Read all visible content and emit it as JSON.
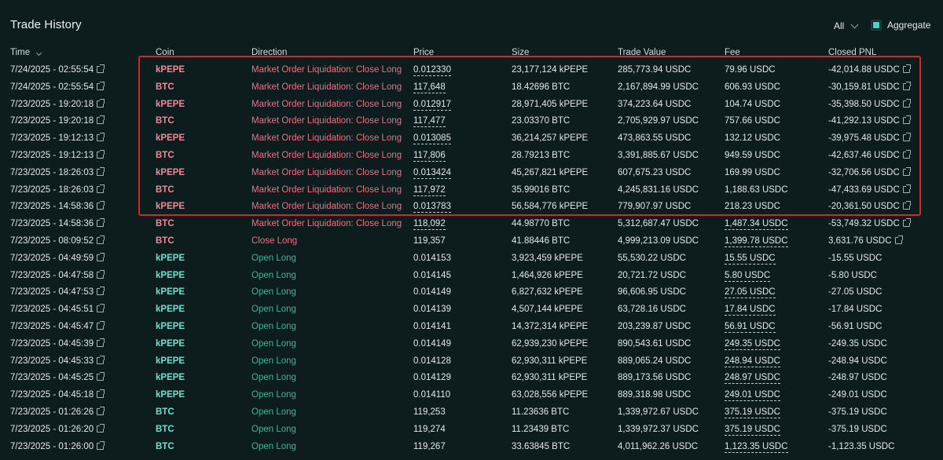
{
  "header": {
    "title": "Trade History",
    "filter_label": "All",
    "aggregate_label": "Aggregate",
    "aggregate_checked": true
  },
  "columns": [
    "Time",
    "Coin",
    "Direction",
    "Price",
    "Size",
    "Trade Value",
    "Fee",
    "Closed PNL"
  ],
  "colors": {
    "background": "#0d1c1c",
    "sell": "#ec7085",
    "buy": "#3bb79a",
    "coin_buy": "#69e3d0",
    "highlight_box": "#d2262b",
    "checkbox": "#51d2c1"
  },
  "rows": [
    {
      "time": "7/24/2025 - 02:55:54",
      "coin": "kPEPE",
      "direction": "Market Order Liquidation: Close Long",
      "price": "0.012330",
      "size": "23,177,124 kPEPE",
      "trade_value": "285,773.94 USDC",
      "fee": "79.96 USDC",
      "pnl": "-42,014.88 USDC",
      "side": "sell",
      "fee_ul": false
    },
    {
      "time": "7/24/2025 - 02:55:54",
      "coin": "BTC",
      "direction": "Market Order Liquidation: Close Long",
      "price": "117,648",
      "size": "18.42696 BTC",
      "trade_value": "2,167,894.99 USDC",
      "fee": "606.93 USDC",
      "pnl": "-30,159.81 USDC",
      "side": "sell",
      "fee_ul": false
    },
    {
      "time": "7/23/2025 - 19:20:18",
      "coin": "kPEPE",
      "direction": "Market Order Liquidation: Close Long",
      "price": "0.012917",
      "size": "28,971,405 kPEPE",
      "trade_value": "374,223.64 USDC",
      "fee": "104.74 USDC",
      "pnl": "-35,398.50 USDC",
      "side": "sell",
      "fee_ul": false
    },
    {
      "time": "7/23/2025 - 19:20:18",
      "coin": "BTC",
      "direction": "Market Order Liquidation: Close Long",
      "price": "117,477",
      "size": "23.03370 BTC",
      "trade_value": "2,705,929.97 USDC",
      "fee": "757.66 USDC",
      "pnl": "-41,292.13 USDC",
      "side": "sell",
      "fee_ul": false
    },
    {
      "time": "7/23/2025 - 19:12:13",
      "coin": "kPEPE",
      "direction": "Market Order Liquidation: Close Long",
      "price": "0.013085",
      "size": "36,214,257 kPEPE",
      "trade_value": "473,863.55 USDC",
      "fee": "132.12 USDC",
      "pnl": "-39,975.48 USDC",
      "side": "sell",
      "fee_ul": false
    },
    {
      "time": "7/23/2025 - 19:12:13",
      "coin": "BTC",
      "direction": "Market Order Liquidation: Close Long",
      "price": "117,806",
      "size": "28.79213 BTC",
      "trade_value": "3,391,885.67 USDC",
      "fee": "949.59 USDC",
      "pnl": "-42,637.46 USDC",
      "side": "sell",
      "fee_ul": false
    },
    {
      "time": "7/23/2025 - 18:26:03",
      "coin": "kPEPE",
      "direction": "Market Order Liquidation: Close Long",
      "price": "0.013424",
      "size": "45,267,821 kPEPE",
      "trade_value": "607,675.23 USDC",
      "fee": "169.99 USDC",
      "pnl": "-32,706.56 USDC",
      "side": "sell",
      "fee_ul": false
    },
    {
      "time": "7/23/2025 - 18:26:03",
      "coin": "BTC",
      "direction": "Market Order Liquidation: Close Long",
      "price": "117,972",
      "size": "35.99016 BTC",
      "trade_value": "4,245,831.16 USDC",
      "fee": "1,188.63 USDC",
      "pnl": "-47,433.69 USDC",
      "side": "sell",
      "fee_ul": false
    },
    {
      "time": "7/23/2025 - 14:58:36",
      "coin": "kPEPE",
      "direction": "Market Order Liquidation: Close Long",
      "price": "0.013783",
      "size": "56,584,776 kPEPE",
      "trade_value": "779,907.97 USDC",
      "fee": "218.23 USDC",
      "pnl": "-20,361.50 USDC",
      "side": "sell",
      "fee_ul": false
    },
    {
      "time": "7/23/2025 - 14:58:36",
      "coin": "BTC",
      "direction": "Market Order Liquidation: Close Long",
      "price": "118,092",
      "size": "44.98770 BTC",
      "trade_value": "5,312,687.47 USDC",
      "fee": "1,487.34 USDC",
      "pnl": "-53,749.32 USDC",
      "side": "sell",
      "fee_ul": true
    },
    {
      "time": "7/23/2025 - 08:09:52",
      "coin": "BTC",
      "direction": "Close Long",
      "price": "119,357",
      "size": "41.88446 BTC",
      "trade_value": "4,999,213.09 USDC",
      "fee": "1,399.78 USDC",
      "pnl": "3,631.76 USDC",
      "side": "sell",
      "fee_ul": true
    },
    {
      "time": "7/23/2025 - 04:49:59",
      "coin": "kPEPE",
      "direction": "Open Long",
      "price": "0.014153",
      "size": "3,923,459 kPEPE",
      "trade_value": "55,530.22 USDC",
      "fee": "15.55 USDC",
      "pnl": "-15.55 USDC",
      "side": "buy",
      "fee_ul": true
    },
    {
      "time": "7/23/2025 - 04:47:58",
      "coin": "kPEPE",
      "direction": "Open Long",
      "price": "0.014145",
      "size": "1,464,926 kPEPE",
      "trade_value": "20,721.72 USDC",
      "fee": "5.80 USDC",
      "pnl": "-5.80 USDC",
      "side": "buy",
      "fee_ul": true
    },
    {
      "time": "7/23/2025 - 04:47:53",
      "coin": "kPEPE",
      "direction": "Open Long",
      "price": "0.014149",
      "size": "6,827,632 kPEPE",
      "trade_value": "96,606.95 USDC",
      "fee": "27.05 USDC",
      "pnl": "-27.05 USDC",
      "side": "buy",
      "fee_ul": true
    },
    {
      "time": "7/23/2025 - 04:45:51",
      "coin": "kPEPE",
      "direction": "Open Long",
      "price": "0.014139",
      "size": "4,507,144 kPEPE",
      "trade_value": "63,728.16 USDC",
      "fee": "17.84 USDC",
      "pnl": "-17.84 USDC",
      "side": "buy",
      "fee_ul": true
    },
    {
      "time": "7/23/2025 - 04:45:47",
      "coin": "kPEPE",
      "direction": "Open Long",
      "price": "0.014141",
      "size": "14,372,314 kPEPE",
      "trade_value": "203,239.87 USDC",
      "fee": "56.91 USDC",
      "pnl": "-56.91 USDC",
      "side": "buy",
      "fee_ul": true
    },
    {
      "time": "7/23/2025 - 04:45:39",
      "coin": "kPEPE",
      "direction": "Open Long",
      "price": "0.014149",
      "size": "62,939,230 kPEPE",
      "trade_value": "890,543.61 USDC",
      "fee": "249.35 USDC",
      "pnl": "-249.35 USDC",
      "side": "buy",
      "fee_ul": true
    },
    {
      "time": "7/23/2025 - 04:45:33",
      "coin": "kPEPE",
      "direction": "Open Long",
      "price": "0.014128",
      "size": "62,930,311 kPEPE",
      "trade_value": "889,065.24 USDC",
      "fee": "248.94 USDC",
      "pnl": "-248.94 USDC",
      "side": "buy",
      "fee_ul": true
    },
    {
      "time": "7/23/2025 - 04:45:25",
      "coin": "kPEPE",
      "direction": "Open Long",
      "price": "0.014129",
      "size": "62,930,311 kPEPE",
      "trade_value": "889,173.56 USDC",
      "fee": "248.97 USDC",
      "pnl": "-248.97 USDC",
      "side": "buy",
      "fee_ul": true
    },
    {
      "time": "7/23/2025 - 04:45:18",
      "coin": "kPEPE",
      "direction": "Open Long",
      "price": "0.014110",
      "size": "63,028,556 kPEPE",
      "trade_value": "889,318.98 USDC",
      "fee": "249.01 USDC",
      "pnl": "-249.01 USDC",
      "side": "buy",
      "fee_ul": true
    },
    {
      "time": "7/23/2025 - 01:26:26",
      "coin": "BTC",
      "direction": "Open Long",
      "price": "119,253",
      "size": "11.23636 BTC",
      "trade_value": "1,339,972.67 USDC",
      "fee": "375.19 USDC",
      "pnl": "-375.19 USDC",
      "side": "buy",
      "fee_ul": true
    },
    {
      "time": "7/23/2025 - 01:26:20",
      "coin": "BTC",
      "direction": "Open Long",
      "price": "119,274",
      "size": "11.23439 BTC",
      "trade_value": "1,339,972.37 USDC",
      "fee": "375.19 USDC",
      "pnl": "-375.19 USDC",
      "side": "buy",
      "fee_ul": true
    },
    {
      "time": "7/23/2025 - 01:26:00",
      "coin": "BTC",
      "direction": "Open Long",
      "price": "119,267",
      "size": "33.63845 BTC",
      "trade_value": "4,011,962.26 USDC",
      "fee": "1,123.35 USDC",
      "pnl": "-1,123.35 USDC",
      "side": "buy",
      "fee_ul": true
    }
  ]
}
